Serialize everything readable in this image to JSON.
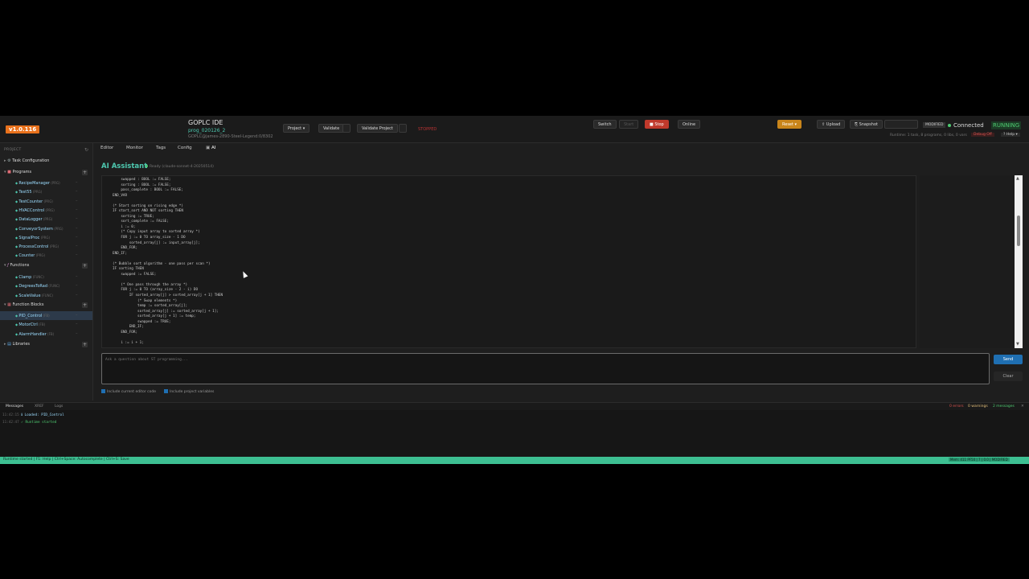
{
  "header": {
    "version": "v1.0.116",
    "ide_title": "GOPLC IDE",
    "program_name": "prog_020126_2",
    "connection_path": "GOPLC@james-2890-Steel-Legend:0/8302",
    "project_label": "Project ▾",
    "validate_label": "Validate",
    "validate_project_label": "Validate Project",
    "stopped_badge": "STOPPED",
    "switch_label": "Switch",
    "start_label": "Start",
    "stop_label": "■ Stop",
    "online_label": "Online",
    "reset_label": "Reset ▾",
    "upload_label": "⇧ Upload",
    "snapshot_label": "⎘ Snapshot",
    "modified_label": "MODIFIED",
    "connected_label": "Connected",
    "running_label": "RUNNING",
    "runtime_info": "Runtime: 1 task, 8 programs, 0 libs, 0 vars",
    "debug_label": "Debug Off",
    "help_label": "? Help ▾"
  },
  "sidebar": {
    "heading": "PROJECT",
    "refresh_icon": "↻",
    "task_config": "Task Configuration",
    "programs_label": "Programs",
    "programs": [
      {
        "name": "RecipeManager",
        "type": "(PRG)"
      },
      {
        "name": "Test55",
        "type": "(PRG)"
      },
      {
        "name": "TestCounter",
        "type": "(PRG)"
      },
      {
        "name": "HVACControl",
        "type": "(PRG)"
      },
      {
        "name": "DataLogger",
        "type": "(PRG)"
      },
      {
        "name": "ConveyorSystem",
        "type": "(PRG)"
      },
      {
        "name": "SignalProc",
        "type": "(PRG)"
      },
      {
        "name": "ProcessControl",
        "type": "(PRG)"
      },
      {
        "name": "Counter",
        "type": "(PRG)"
      }
    ],
    "functions_label": "Functions",
    "functions": [
      {
        "name": "Clamp",
        "type": "(FUNC)"
      },
      {
        "name": "DegreesToRad",
        "type": "(FUNC)"
      },
      {
        "name": "ScaleValue",
        "type": "(FUNC)"
      }
    ],
    "fb_label": "Function Blocks",
    "function_blocks": [
      {
        "name": "PID_Control",
        "type": "(FB)"
      },
      {
        "name": "MotorCtrl",
        "type": "(FB)"
      },
      {
        "name": "AlarmHandler",
        "type": "(FB)"
      }
    ],
    "libraries_label": "Libraries"
  },
  "tabs": [
    "Editor",
    "Monitor",
    "Tags",
    "Config",
    "AI"
  ],
  "ai": {
    "title": "AI Assistant",
    "status": "Ready (claude-sonnet-4-20250514)",
    "code": "    swapped : BOOL := FALSE;\n    sorting : BOOL := FALSE;\n    pass_complete : BOOL := FALSE;\nEND_VAR\n\n(* Start sorting on rising edge *)\nIF start_sort AND NOT sorting THEN\n    sorting := TRUE;\n    sort_complete := FALSE;\n    i := 0;\n    (* Copy input array to sorted array *)\n    FOR j := 0 TO array_size - 1 DO\n        sorted_array[j] := input_array[j];\n    END_FOR;\nEND_IF;\n\n(* Bubble sort algorithm - one pass per scan *)\nIF sorting THEN\n    swapped := FALSE;\n\n    (* One pass through the array *)\n    FOR j := 0 TO (array_size - 2 - i) DO\n        IF sorted_array[j] > sorted_array[j + 1] THEN\n            (* Swap elements *)\n            temp := sorted_array[j];\n            sorted_array[j] := sorted_array[j + 1];\n            sorted_array[j + 1] := temp;\n            swapped := TRUE;\n        END_IF;\n    END_FOR;\n\n    i := i + 1;",
    "input_placeholder": "Ask a question about ST programming...",
    "send_label": "Send",
    "clear_label": "Clear",
    "opt_editor": "Include current editor code",
    "opt_vars": "Include project variables"
  },
  "messages": {
    "tabs": [
      "Messages",
      "XREF",
      "Logs"
    ],
    "errors": "0 errors",
    "warnings": "0 warnings",
    "count": "2 messages",
    "rows": [
      {
        "time": "11:42:15",
        "icon": "ℹ",
        "text": "Loaded: PID_Control",
        "kind": "info"
      },
      {
        "time": "11:42:47",
        "icon": "✓",
        "text": "Runtime started",
        "kind": "ok"
      }
    ]
  },
  "statusbar": {
    "left": "Runtime started | F1: Help | Ctrl+Space: Autocomplete | Ctrl+S: Save",
    "right": "Mem: 411 PF50 | 7 | 0.0 | MODIFIED"
  },
  "colors": {
    "accent": "#4ec9b0",
    "version_badge": "#e8711c",
    "stop": "#c0392b",
    "reset": "#c9851a",
    "statusbar": "#3dbf92",
    "send": "#1f6fb2"
  }
}
